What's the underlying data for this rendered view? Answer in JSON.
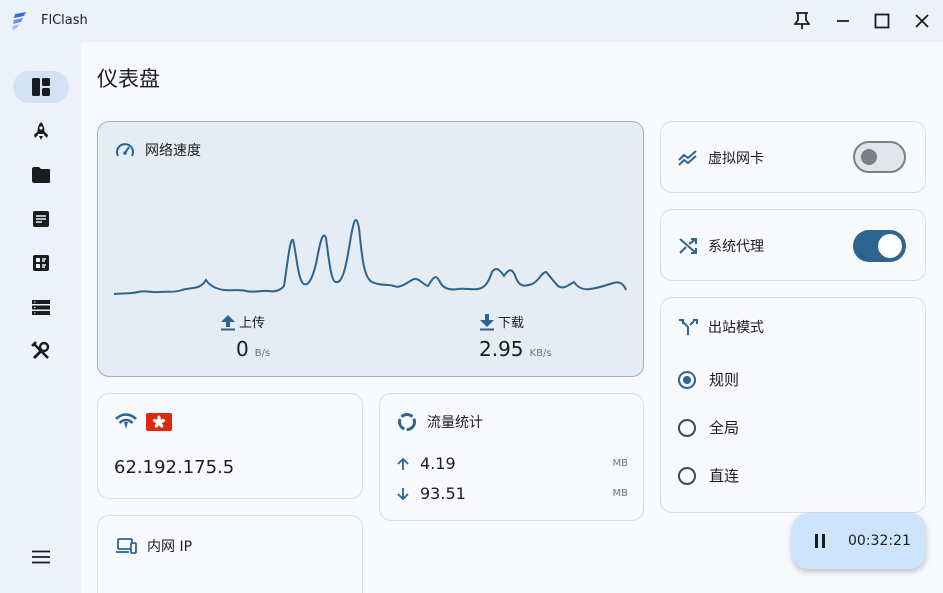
{
  "app": {
    "title": "FlClash"
  },
  "page": {
    "title": "仪表盘"
  },
  "nav": {
    "items": [
      {
        "icon": "dashboard-icon",
        "active": true
      },
      {
        "icon": "rocket-icon",
        "active": false
      },
      {
        "icon": "folder-icon",
        "active": false
      },
      {
        "icon": "logs-icon",
        "active": false
      },
      {
        "icon": "resources-icon",
        "active": false
      },
      {
        "icon": "connections-list-icon",
        "active": false
      },
      {
        "icon": "tools-icon",
        "active": false
      }
    ],
    "menu_icon": "menu-icon"
  },
  "speed": {
    "title": "网络速度",
    "upload_label": "上传",
    "upload_value": "0",
    "upload_unit": "B/s",
    "download_label": "下载",
    "download_value": "2.95",
    "download_unit": "KB/s"
  },
  "ip_card": {
    "value": "62.192.175.5",
    "flag": "hong-kong-flag-icon"
  },
  "traffic": {
    "title": "流量统计",
    "up_value": "4.19",
    "up_unit": "MB",
    "down_value": "93.51",
    "down_unit": "MB"
  },
  "intranet": {
    "title": "内网 IP"
  },
  "tun": {
    "label": "虚拟网卡",
    "enabled": false
  },
  "system_proxy": {
    "label": "系统代理",
    "enabled": true
  },
  "outbound": {
    "title": "出站模式",
    "options": [
      {
        "label": "规则",
        "selected": true
      },
      {
        "label": "全局",
        "selected": false
      },
      {
        "label": "直连",
        "selected": false
      }
    ]
  },
  "fab": {
    "time": "00:32:21"
  },
  "colors": {
    "accent": "#2d6590",
    "nav_active": "#d3e3f5",
    "fab": "#cde5fb"
  }
}
